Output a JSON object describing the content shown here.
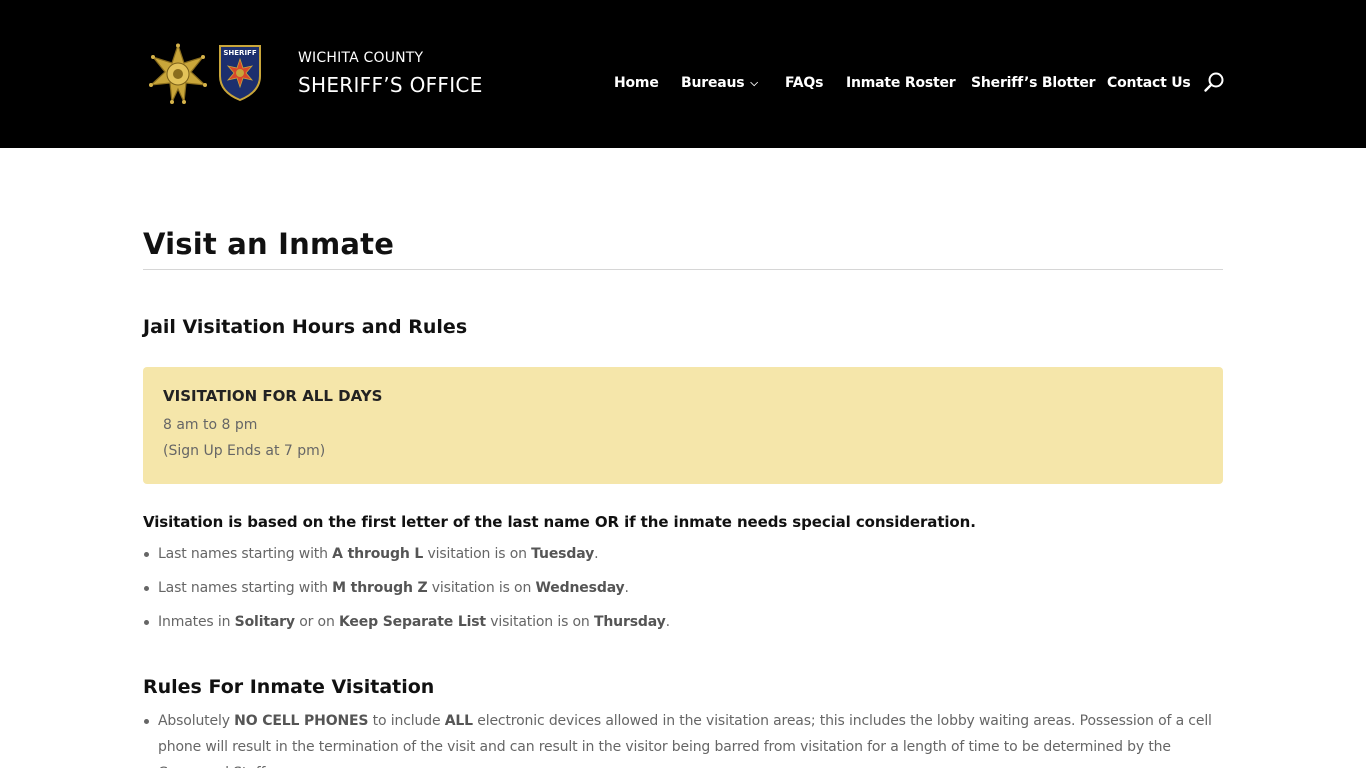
{
  "header": {
    "brand_line1": "WICHITA COUNTY",
    "brand_line2": "SHERIFF’S OFFICE",
    "badge_text": "SHERIFF",
    "nav": [
      {
        "label": "Home"
      },
      {
        "label": "Bureaus",
        "has_dropdown": true
      },
      {
        "label": "FAQs"
      },
      {
        "label": "Inmate Roster"
      },
      {
        "label": "Sheriff’s Blotter"
      },
      {
        "label": "Contact Us"
      }
    ],
    "search_icon": "search-icon",
    "colors": {
      "background": "#000000",
      "text": "#ffffff"
    }
  },
  "main": {
    "page_title": "Visit an Inmate",
    "section1_heading": "Jail Visitation Hours and Rules",
    "hours_box": {
      "title": "VISITATION FOR ALL DAYS",
      "line1": "8 am to 8 pm",
      "line2": "(Sign Up Ends at 7 pm)",
      "background": "#f5e6aa"
    },
    "intro": "Visitation is based on the first letter of the last name OR if the inmate needs special consideration.",
    "schedule": [
      {
        "pre": "Last names starting with ",
        "b1": "A through L",
        "mid": " visitation is on ",
        "b2": "Tuesday",
        "post": "."
      },
      {
        "pre": "Last names starting with ",
        "b1": "M through Z",
        "mid": " visitation is on ",
        "b2": "Wednesday",
        "post": "."
      },
      {
        "pre": "Inmates in ",
        "b1": "Solitary",
        "mid1": " or on ",
        "b1b": "Keep Separate List",
        "mid": " visitation is on ",
        "b2": "Thursday",
        "post": "."
      }
    ],
    "section2_heading": "Rules For Inmate Visitation",
    "rules": [
      {
        "pre": "Absolutely ",
        "b1": "NO CELL PHONES",
        "mid": " to include ",
        "b2": "ALL",
        "post": " electronic devices allowed in the visitation areas; this includes the lobby waiting areas. Possession of a cell phone will result in the termination of the visit and can result in the visitor being barred from visitation for a length of time to be determined by the Command Staff."
      }
    ]
  }
}
